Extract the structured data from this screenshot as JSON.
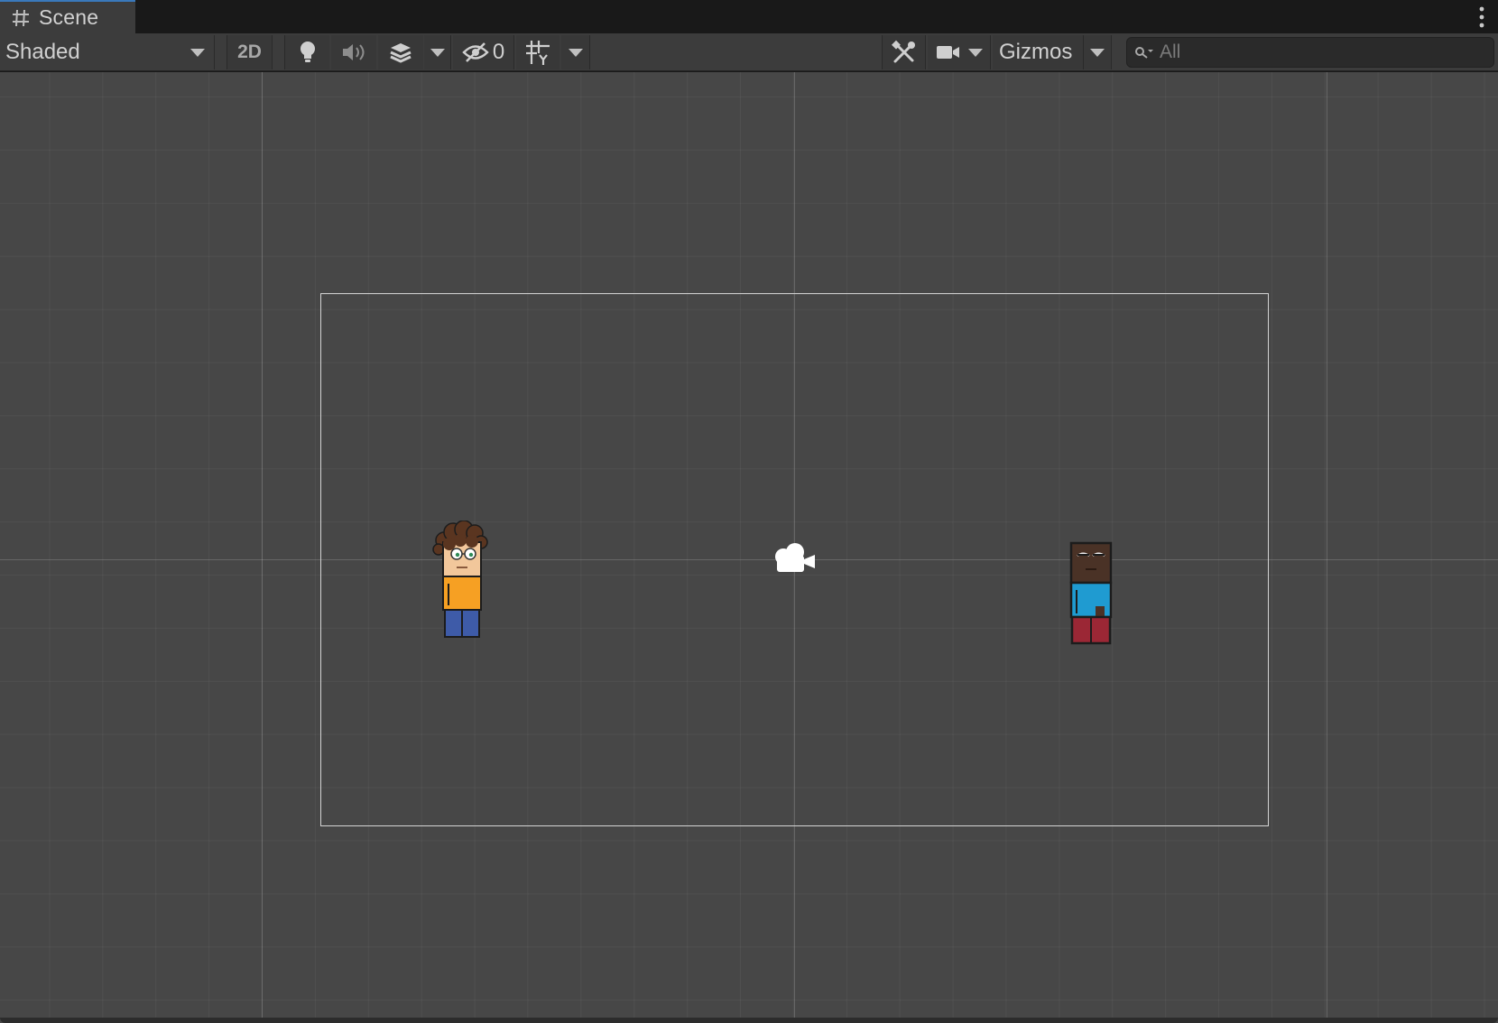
{
  "window": {
    "tab_label": "Scene",
    "tab_icon": "scene-grid-icon",
    "menu_icon": "kebab-menu-icon"
  },
  "toolbar": {
    "draw_mode": "Shaded",
    "mode_2d": "2D",
    "hidden_count": "0",
    "gizmos_label": "Gizmos",
    "search_placeholder": "All",
    "icons": [
      "light-bulb-icon",
      "audio-icon",
      "effects-icon",
      "visibility-icon",
      "grid-snap-icon",
      "tools-icon",
      "camera-icon",
      "search-icon"
    ]
  },
  "scene": {
    "objects": [
      "character-curly-hair-orange-shirt",
      "character-dark-skin-blue-shirt",
      "main-camera"
    ],
    "colors": {
      "background": "#474747",
      "orange_shirt": "#f6a023",
      "blue_pants": "#3e5ba8",
      "blue_shirt": "#1f9bd1",
      "red_pants": "#9b2735",
      "skin_light": "#f2c79b",
      "skin_dark": "#4a3226",
      "hair": "#5a3520"
    }
  }
}
